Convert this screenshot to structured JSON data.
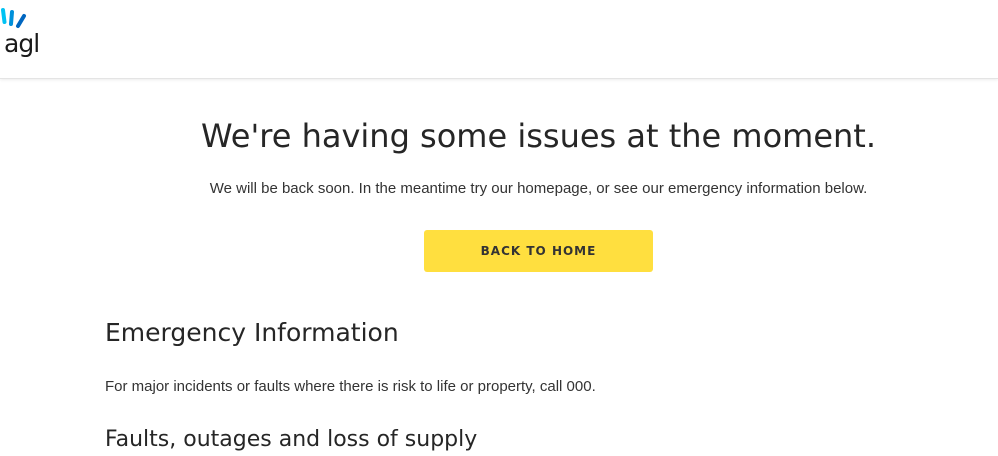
{
  "header": {
    "logo_text": "agl",
    "logo_colors": [
      "#00c2f3",
      "#0090da",
      "#0066c0"
    ]
  },
  "main": {
    "title": "We're having some issues at the moment.",
    "subtitle": "We will be back soon. In the meantime try our homepage, or see our emergency information below.",
    "back_button_label": "BACK TO HOME",
    "accent_color": "#ffdf3f"
  },
  "emergency": {
    "heading": "Emergency Information",
    "text": "For major incidents or faults where there is risk to life or property, call 000."
  },
  "faults": {
    "heading": "Faults, outages and loss of supply"
  }
}
